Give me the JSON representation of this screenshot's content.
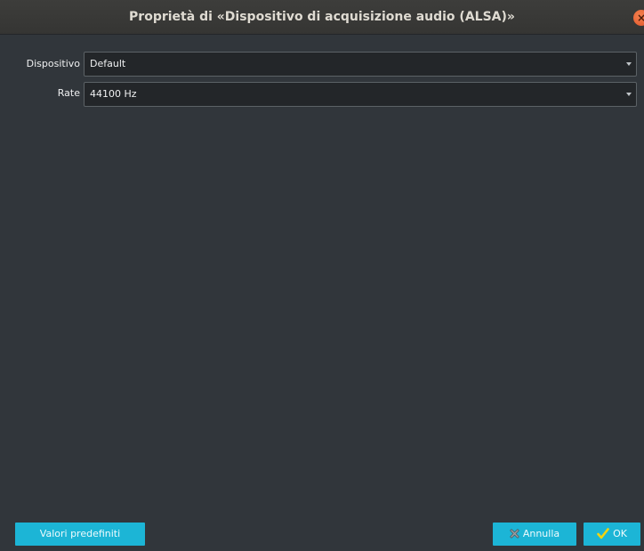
{
  "window": {
    "title": "Proprietà di «Dispositivo di acquisizione audio (ALSA)»",
    "close_icon": "close-icon"
  },
  "form": {
    "device": {
      "label": "Dispositivo",
      "value": "Default"
    },
    "rate": {
      "label": "Rate",
      "value": "44100 Hz"
    }
  },
  "footer": {
    "defaults_label": "Valori predefiniti",
    "cancel_label": "Annulla",
    "cancel_icon": "cross-icon",
    "ok_label": "OK",
    "ok_icon": "checkmark-icon"
  },
  "colors": {
    "background": "#31363b",
    "button": "#1cb5d6",
    "close_button": "#e2552a",
    "ok_check": "#f3d40f"
  }
}
